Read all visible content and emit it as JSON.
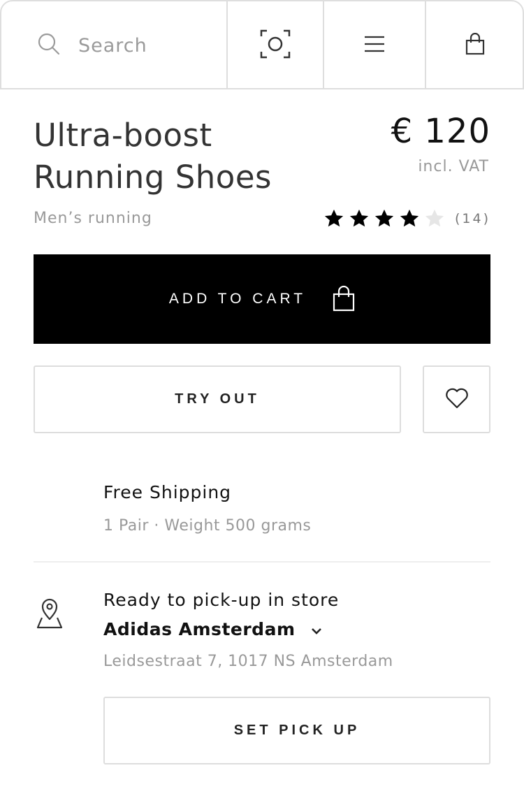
{
  "header": {
    "search_placeholder": "Search",
    "icons": [
      "search-icon",
      "scan-icon",
      "menu-icon",
      "shopping-bag-icon"
    ]
  },
  "product": {
    "title_line1": "Ultra-boost",
    "title_line2": "Running Shoes",
    "category": "Men’s running",
    "price": "€ 120",
    "vat_note": "incl. VAT",
    "rating": 4,
    "rating_max": 5,
    "rating_count": "(14)"
  },
  "actions": {
    "add_to_cart": "ADD TO CART",
    "try_out": "TRY OUT",
    "set_pick_up": "SET PICK UP"
  },
  "shipping": {
    "title": "Free Shipping",
    "detail": "1 Pair · Weight 500 grams"
  },
  "pickup": {
    "title": "Ready to pick-up in store",
    "store": "Adidas Amsterdam",
    "address": "Leidsestraat 7, 1017 NS Amsterdam"
  },
  "colors": {
    "primary": "#000000",
    "muted_text": "#999999",
    "border": "#dddddd",
    "star_filled": "#000000",
    "star_empty": "#e6e6e6"
  }
}
